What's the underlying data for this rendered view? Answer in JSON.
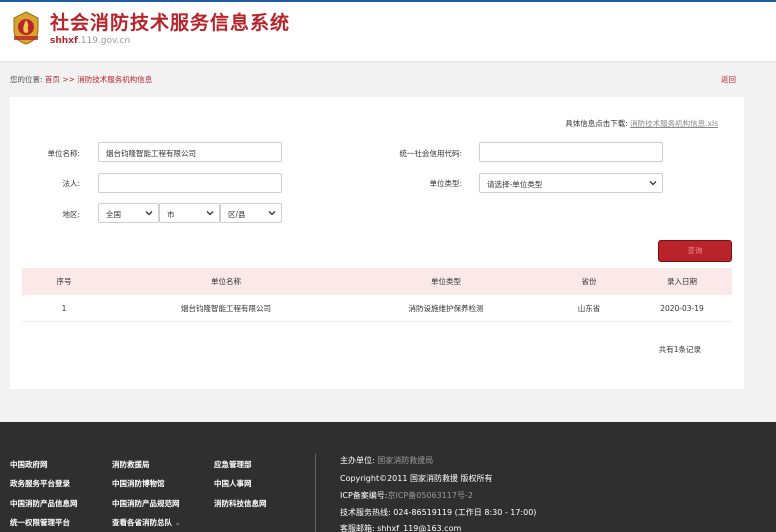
{
  "header": {
    "title": "社会消防技术服务信息系统",
    "domain_prefix": "shhxf",
    "domain_suffix": ".119.gov.cn"
  },
  "breadcrumb": {
    "prefix": "您的位置:",
    "home": "首页",
    "separator": ">>",
    "current": "消防技术服务机构信息",
    "back": "返回"
  },
  "download": {
    "label": "具体信息点击下载:",
    "link": "消防技术服务机构信息.xls"
  },
  "form": {
    "unit_name_label": "单位名称:",
    "unit_name_value": "烟台钧隆智能工程有限公司",
    "credit_code_label": "统一社会信用代码:",
    "credit_code_value": "",
    "legal_label": "法人:",
    "legal_value": "",
    "unit_type_label": "单位类型:",
    "unit_type_value": "请选择-单位类型",
    "region_label": "地区:",
    "region_country": "全国",
    "region_city": "市",
    "region_district": "区/县",
    "query_button": "查询"
  },
  "table": {
    "headers": [
      "序号",
      "单位名称",
      "单位类型",
      "省份",
      "录入日期"
    ],
    "rows": [
      [
        "1",
        "烟台钧隆智能工程有限公司",
        "消防设施维护保养检测",
        "山东省",
        "2020-03-19"
      ]
    ],
    "total": "共有1条记录"
  },
  "footer": {
    "links_col1": [
      "中国政府网",
      "政务服务平台登录",
      "中国消防产品信息网",
      "统一权限管理平台"
    ],
    "links_col2": [
      "消防救援局",
      "中国消防博物馆",
      "中国消防产品规范网",
      "查看各省消防总队"
    ],
    "links_col3": [
      "应急管理部",
      "中国人事网",
      "消防科技信息网"
    ],
    "info_host_label": "主办单位:",
    "info_host": "国家消防救援局",
    "copyright": "Copyright©2011 国家消防救援 版权所有",
    "icp_label": "ICP备案编号:",
    "icp": "京ICP备05063117号-2",
    "hotline": "技术服务热线: 024-86519119 (工作日 8:30 - 17:00)",
    "email": "客服邮箱: shhxf_119@163.com"
  },
  "colors": {
    "brand_red": "#b8242a",
    "footer_bg": "#2f2f2f",
    "header_accent": "#1f5aa6"
  }
}
